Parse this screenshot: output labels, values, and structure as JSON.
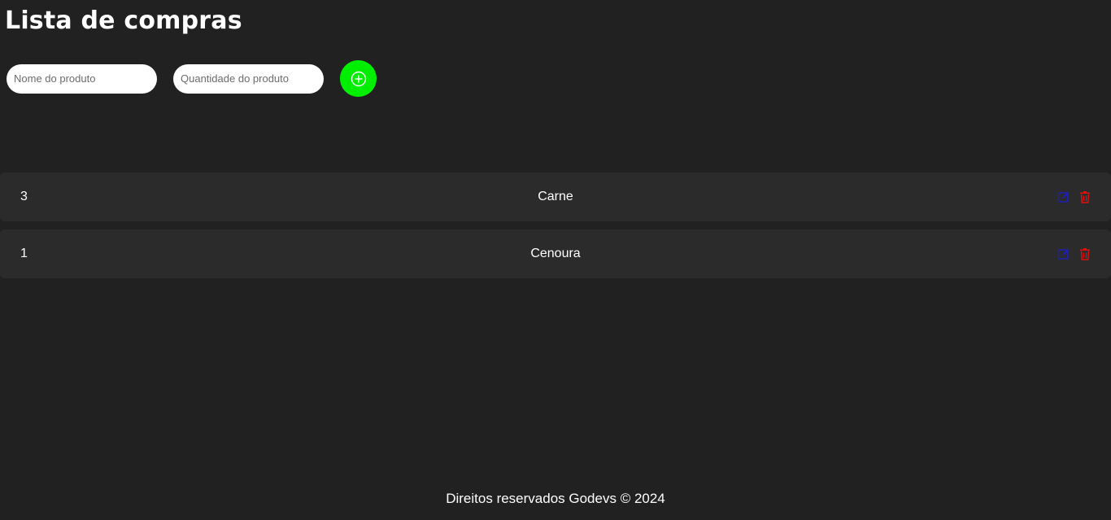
{
  "header": {
    "title": "Lista de compras"
  },
  "form": {
    "product_name_placeholder": "Nome do produto",
    "product_name_value": "",
    "quantity_placeholder": "Quantidade do produto",
    "quantity_value": "",
    "add_button_icon": "plus-circle-icon"
  },
  "items": [
    {
      "quantity": "3",
      "name": "Carne"
    },
    {
      "quantity": "1",
      "name": "Cenoura"
    }
  ],
  "actions": {
    "edit_icon": "edit-icon",
    "delete_icon": "trash-icon"
  },
  "footer": {
    "text": "Direitos reservados Godevs © 2024"
  },
  "colors": {
    "background": "#212121",
    "row_background": "#2b2b2b",
    "accent_green": "#00ee00",
    "edit_blue": "#1f1fb3",
    "delete_red": "#e01010"
  }
}
